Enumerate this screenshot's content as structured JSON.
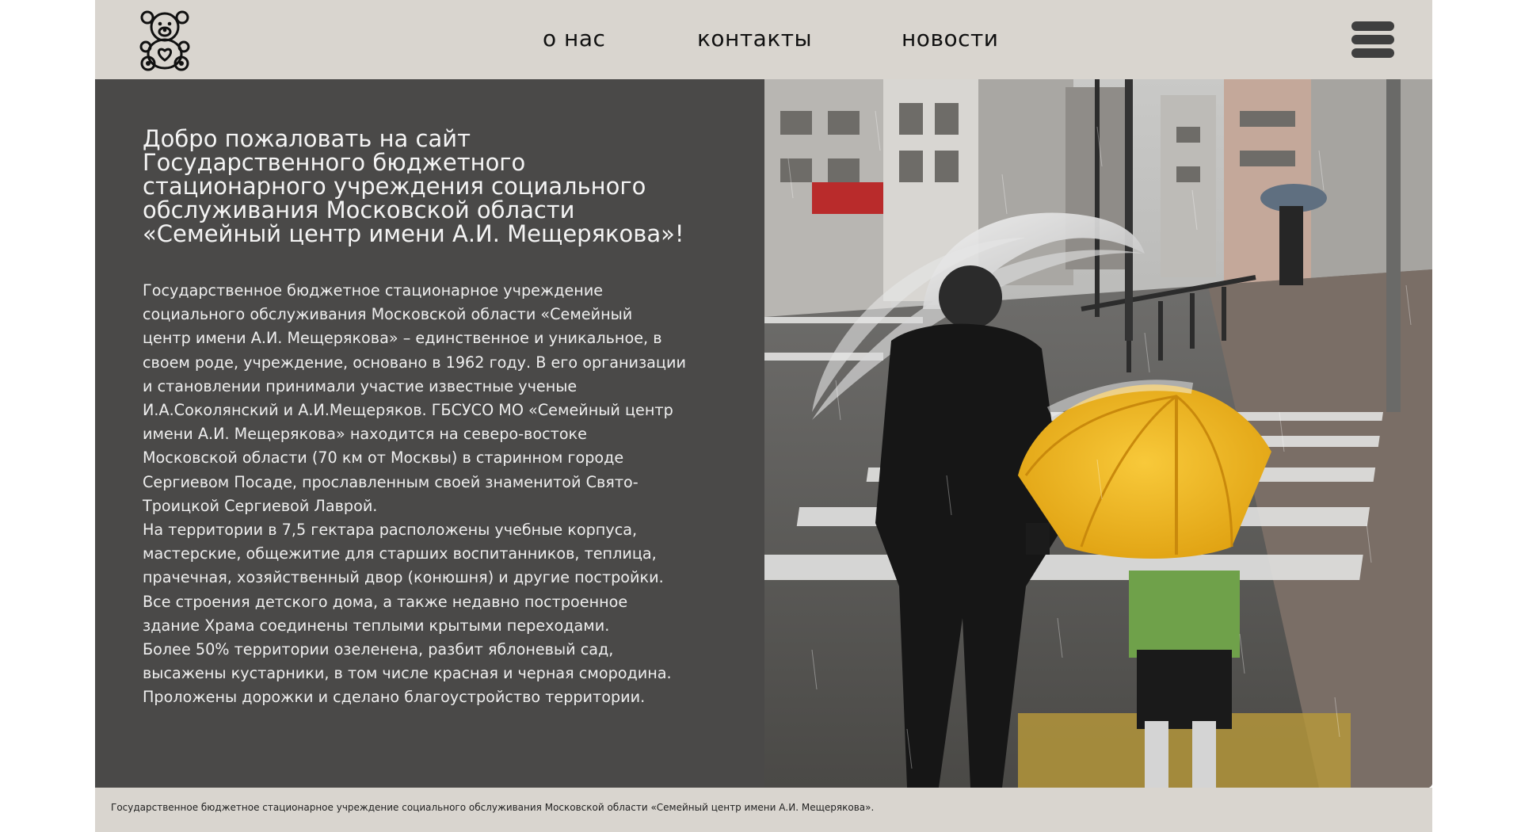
{
  "header": {
    "logo_icon": "teddy-bear-icon",
    "nav": {
      "about": "о нас",
      "contacts": "контакты",
      "news": "новости"
    },
    "menu_icon": "hamburger-menu-icon"
  },
  "main": {
    "title_lines": [
      "Добро пожаловать на сайт",
      "Государственного бюджетного",
      "стационарного учреждения социального",
      "обслуживания Московской области",
      "«Семейный центр имени А.И. Мещерякова»!"
    ],
    "body_lines": [
      "Государственное бюджетное стационарное учреждение",
      "социального обслуживания Московской области «Семейный",
      "центр имени А.И. Мещерякова» – единственное и уникальное, в",
      "своем роде, учреждение, основано в 1962 году. В его организации",
      "и становлении принимали участие известные ученые",
      "И.А.Соколянский и А.И.Мещеряков. ГБСУСО МО «Семейный центр",
      "имени А.И. Мещерякова» находится на северо-востоке",
      "Московской области (70 км от Москвы) в старинном городе",
      "Сергиевом Посаде, прославленным своей знаменитой Свято-",
      "Троицкой Сергиевой Лаврой.",
      "На территории в 7,5 гектара расположены учебные корпуса,",
      "мастерские, общежитие для старших воспитанников, теплица,",
      "прачечная, хозяйственный двор (конюшня) и другие постройки.",
      "Все строения детского дома, а также недавно построенное",
      "здание Храма соединены теплыми крытыми переходами.",
      "Более 50% территории озеленена, разбит яблоневый сад,",
      "высажены кустарники, в том числе красная и черная смородина.",
      "Проложены дорожки и сделано благоустройство территории."
    ],
    "photo_icon": "rainy-street-umbrellas-photo"
  },
  "footer": {
    "text": "Государственное бюджетное стационарное учреждение социального обслуживания Московской области «Семейный центр имени А.И. Мещерякова»."
  },
  "colors": {
    "header_bg": "#d9d5cf",
    "panel_bg": "#4a4948",
    "umbrella_yellow": "#f2b21b"
  }
}
